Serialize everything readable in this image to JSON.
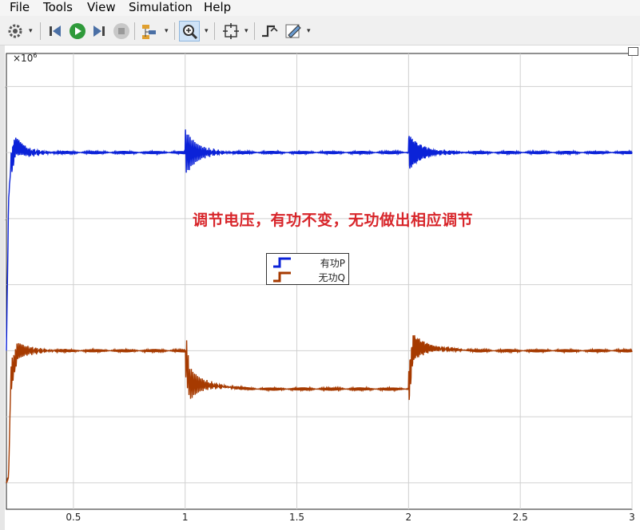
{
  "menu": [
    "File",
    "Tools",
    "View",
    "Simulation",
    "Help"
  ],
  "toolbar": {
    "icons": [
      "gear-icon",
      "step-back-icon",
      "run-icon",
      "step-forward-icon",
      "stop-icon",
      "signal-hierarchy-icon",
      "zoom-in-icon",
      "fit-to-view-icon",
      "trigger-icon",
      "style-icon"
    ]
  },
  "scope": {
    "exponent_base": "×10",
    "exponent_power": "6",
    "annotation": "调节电压，有功不变，无功做出相应调节",
    "legend": [
      {
        "label": "有功P",
        "color": "#0b22d8"
      },
      {
        "label": "无功Q",
        "color": "#a63a00"
      }
    ]
  },
  "chart_data": {
    "type": "line",
    "xlim": [
      0.2,
      3.0
    ],
    "ylim": [
      -0.4,
      6.5
    ],
    "grid": true,
    "legend_placement": "center",
    "x_ticks": [
      "0.5",
      "1",
      "1.5",
      "2",
      "2.5",
      "3"
    ],
    "y_ticks": [
      "0",
      "1",
      "2",
      "3",
      "4",
      "5",
      "6"
    ],
    "series": [
      {
        "name": "有功P",
        "color": "#0b22d8",
        "x": [
          0.2,
          0.21,
          0.22,
          0.24,
          0.3,
          1.0,
          1.02,
          1.2,
          2.0,
          2.02,
          2.2,
          3.0
        ],
        "y": [
          2.0,
          4.3,
          4.8,
          5.1,
          5.0,
          5.0,
          5.0,
          5.0,
          5.0,
          5.0,
          5.0,
          5.0
        ]
      },
      {
        "name": "无功Q",
        "color": "#a63a00",
        "x": [
          0.2,
          0.21,
          0.22,
          0.25,
          0.35,
          1.0,
          1.02,
          1.3,
          2.0,
          2.02,
          2.3,
          3.0
        ],
        "y": [
          0.0,
          0.1,
          1.6,
          2.0,
          2.0,
          2.0,
          1.5,
          1.42,
          1.42,
          2.05,
          2.0,
          2.0
        ]
      }
    ]
  }
}
